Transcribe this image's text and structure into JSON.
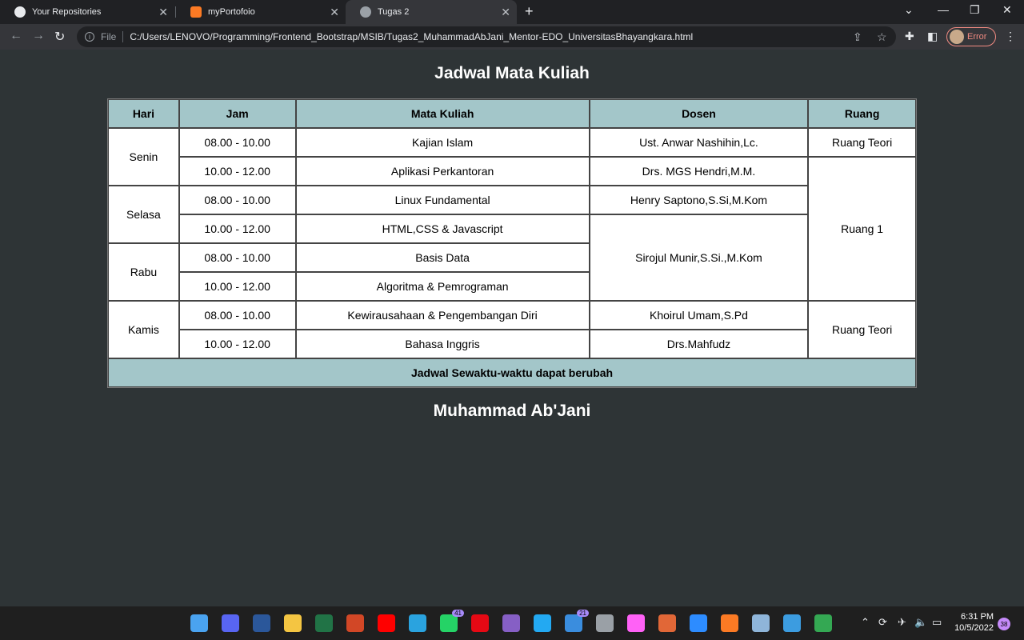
{
  "browser": {
    "tabs": [
      {
        "title": "Your Repositories",
        "active": false,
        "icon": "github-icon"
      },
      {
        "title": "myPortofoio",
        "active": false,
        "icon": "portfolio-icon"
      },
      {
        "title": "Tugas 2",
        "active": true,
        "icon": "globe-icon"
      }
    ],
    "new_tab_label": "+",
    "address": {
      "scheme_label": "File",
      "url": "C:/Users/LENOVO/Programming/Frontend_Bootstrap/MSIB/Tugas2_MuhammadAbJani_Mentor-EDO_UniversitasBhayangkara.html"
    },
    "profile_label": "Error"
  },
  "page": {
    "title": "Jadwal Mata Kuliah",
    "table": {
      "headers": [
        "Hari",
        "Jam",
        "Mata Kuliah",
        "Dosen",
        "Ruang"
      ],
      "days": [
        "Senin",
        "Selasa",
        "Rabu",
        "Kamis"
      ],
      "rows": [
        {
          "jam": "08.00 - 10.00",
          "mata_kuliah": "Kajian Islam",
          "dosen": "Ust. Anwar Nashihin,Lc.",
          "ruang": "Ruang Teori"
        },
        {
          "jam": "10.00 - 12.00",
          "mata_kuliah": "Aplikasi Perkantoran",
          "dosen": "Drs. MGS Hendri,M.M.",
          "ruang": "Ruang 1"
        },
        {
          "jam": "08.00 - 10.00",
          "mata_kuliah": "Linux Fundamental",
          "dosen": "Henry Saptono,S.Si,M.Kom"
        },
        {
          "jam": "10.00 - 12.00",
          "mata_kuliah": "HTML,CSS & Javascript",
          "dosen": "Sirojul Munir,S.Si.,M.Kom"
        },
        {
          "jam": "08.00 - 10.00",
          "mata_kuliah": "Basis Data"
        },
        {
          "jam": "10.00 - 12.00",
          "mata_kuliah": "Algoritma & Pemrograman"
        },
        {
          "jam": "08.00 - 10.00",
          "mata_kuliah": "Kewirausahaan & Pengembangan Diri",
          "dosen": "Khoirul Umam,S.Pd",
          "ruang": "Ruang Teori"
        },
        {
          "jam": "10.00 - 12.00",
          "mata_kuliah": "Bahasa Inggris",
          "dosen": "Drs.Mahfudz"
        }
      ],
      "footer": "Jadwal Sewaktu-waktu dapat berubah"
    },
    "author": "Muhammad Ab'Jani"
  },
  "taskbar": {
    "apps": [
      {
        "name": "start-icon",
        "color": "#4aa3f0"
      },
      {
        "name": "discord-icon",
        "color": "#5865f2"
      },
      {
        "name": "word-icon",
        "color": "#2b579a"
      },
      {
        "name": "file-explorer-icon",
        "color": "#f4c542"
      },
      {
        "name": "excel-icon",
        "color": "#217346"
      },
      {
        "name": "powerpoint-icon",
        "color": "#d24726"
      },
      {
        "name": "youtube-music-icon",
        "color": "#ff0000"
      },
      {
        "name": "telegram-icon",
        "color": "#2aa3df"
      },
      {
        "name": "whatsapp-icon",
        "color": "#25d366",
        "badge": "41"
      },
      {
        "name": "netflix-icon",
        "color": "#e50914"
      },
      {
        "name": "visual-studio-icon",
        "color": "#865fc5"
      },
      {
        "name": "vscode-icon",
        "color": "#23a9f2"
      },
      {
        "name": "mail-icon",
        "color": "#3a8dde",
        "badge": "21"
      },
      {
        "name": "snipping-tool-icon",
        "color": "#9aa0a6"
      },
      {
        "name": "adobe-xd-icon",
        "color": "#ff61f6"
      },
      {
        "name": "matlab-icon",
        "color": "#e16737"
      },
      {
        "name": "zoom-icon",
        "color": "#2d8cff"
      },
      {
        "name": "xampp-icon",
        "color": "#fb7a24"
      },
      {
        "name": "virtualbox-icon",
        "color": "#8fb5d9"
      },
      {
        "name": "sourcetree-icon",
        "color": "#3c9ce0"
      },
      {
        "name": "chrome-icon",
        "color": "#34a853"
      }
    ],
    "clock_time": "6:31 PM",
    "clock_date": "10/5/2022",
    "notification_count": "38"
  },
  "colors": {
    "page_bg": "#2e3436",
    "table_header_bg": "#a3c6c9"
  }
}
